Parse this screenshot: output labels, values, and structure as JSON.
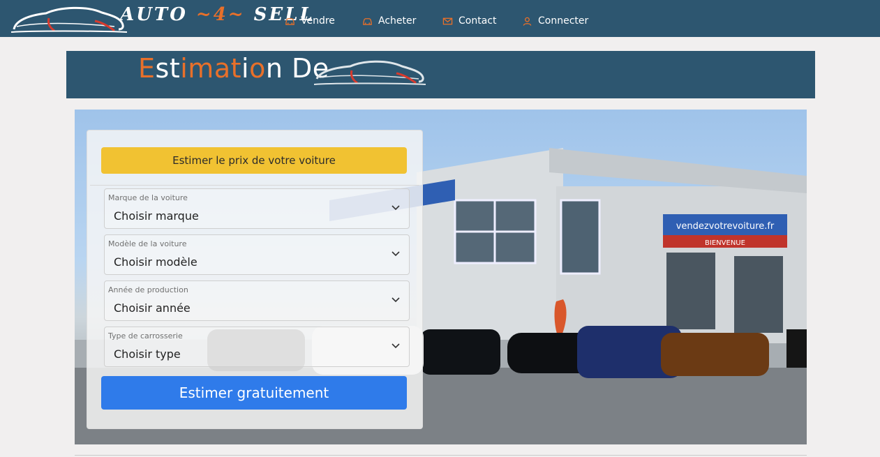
{
  "brand": {
    "name_part1": "AUTO ",
    "name_accent": "~4~",
    "name_part2": " SELL"
  },
  "nav": {
    "items": [
      {
        "label": "Vendre",
        "icon": "car-icon"
      },
      {
        "label": "Acheter",
        "icon": "car-icon"
      },
      {
        "label": "Contact",
        "icon": "envelope-icon"
      },
      {
        "label": "Connecter",
        "icon": "user-icon"
      }
    ]
  },
  "banner": {
    "title_parts": [
      "E",
      "st",
      "i",
      "m",
      "at",
      "i",
      "o",
      "n De"
    ]
  },
  "form": {
    "header_label": "Estimer le prix de votre voiture",
    "fields": [
      {
        "label": "Marque de la voiture",
        "value": "Choisir marque"
      },
      {
        "label": "Modèle de la voiture",
        "value": "Choisir modèle"
      },
      {
        "label": "Année de production",
        "value": "Choisir année"
      },
      {
        "label": "Type de carrosserie",
        "value": "Choisir type"
      }
    ],
    "submit_label": "Estimer gratuitement"
  },
  "hero": {
    "sign_text": "vendezvotrevoiture.fr",
    "sign_subtext": "BIENVENUE"
  },
  "colors": {
    "navy": "#2d5670",
    "orange": "#e8702a",
    "yellow": "#f1c232",
    "blue": "#2f7bea"
  }
}
